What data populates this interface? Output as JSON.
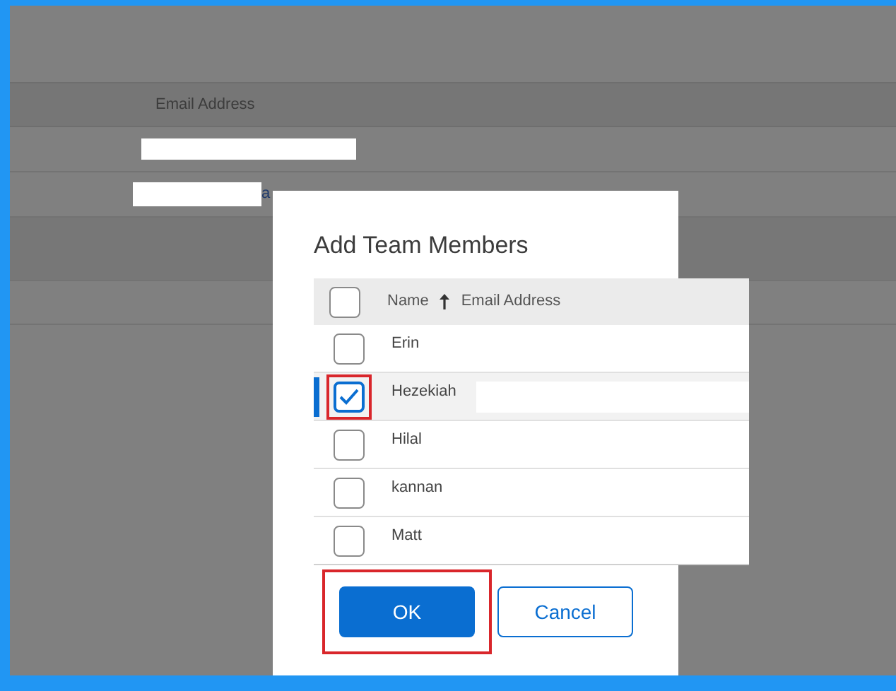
{
  "background_table": {
    "columns": [
      "Email Address"
    ],
    "visible_fragment": "a"
  },
  "dialog": {
    "title": "Add Team Members",
    "header_checkbox": {
      "checked": false
    },
    "columns": [
      {
        "label": "Name",
        "sorted": true
      },
      {
        "label": "Email Address",
        "sorted": false
      }
    ],
    "rows": [
      {
        "name": "Erin",
        "checked": false,
        "selected": false,
        "highlighted": false
      },
      {
        "name": "Hezekiah",
        "checked": true,
        "selected": true,
        "highlighted": true
      },
      {
        "name": "Hilal",
        "checked": false,
        "selected": false,
        "highlighted": false
      },
      {
        "name": "kannan",
        "checked": false,
        "selected": false,
        "highlighted": false
      },
      {
        "name": "Matt",
        "checked": false,
        "selected": false,
        "highlighted": false
      }
    ],
    "buttons": [
      {
        "label": "OK",
        "kind": "primary",
        "highlighted": true
      },
      {
        "label": "Cancel",
        "kind": "secondary",
        "highlighted": false
      }
    ]
  }
}
